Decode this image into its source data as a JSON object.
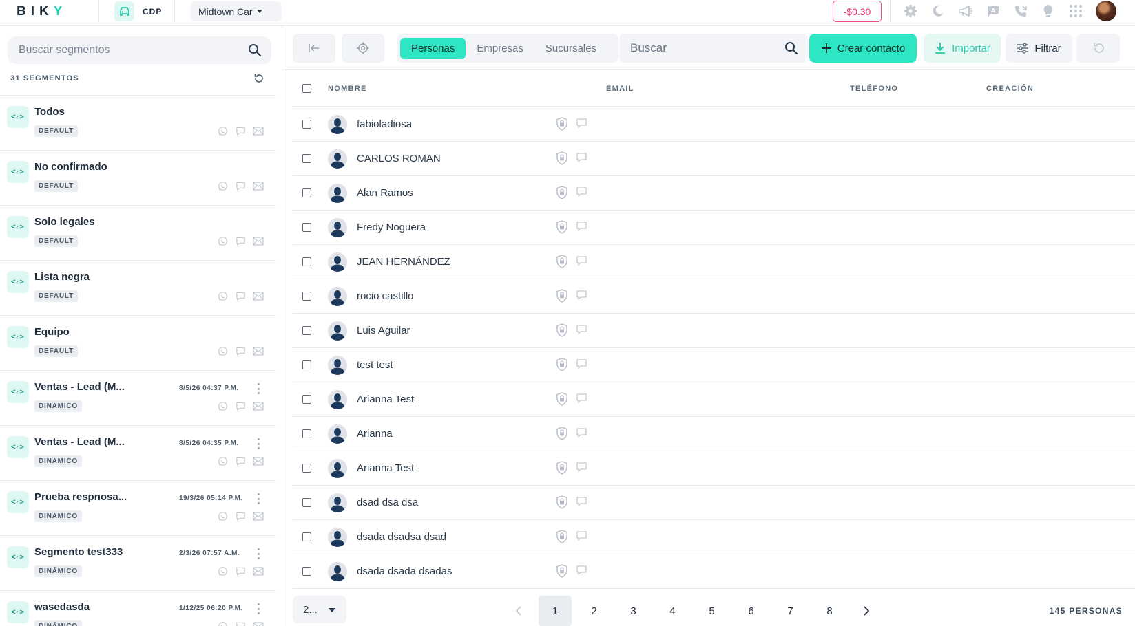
{
  "topbar": {
    "logo": "BIKY",
    "module": "CDP",
    "account": "Midtown Car",
    "balance": "-$0.30",
    "icons": [
      "settings-icon",
      "moon-icon",
      "megaphone-icon",
      "chat-letter-icon",
      "phone-icon",
      "lightbulb-icon",
      "apps-grid-icon",
      "avatar"
    ]
  },
  "sidebar": {
    "search_placeholder": "Buscar segmentos",
    "count_label": "31 SEGMENTOS",
    "segments": [
      {
        "name": "Todos",
        "badge": "DEFAULT",
        "date": ""
      },
      {
        "name": "No confirmado",
        "badge": "DEFAULT",
        "date": ""
      },
      {
        "name": "Solo legales",
        "badge": "DEFAULT",
        "date": ""
      },
      {
        "name": "Lista negra",
        "badge": "DEFAULT",
        "date": ""
      },
      {
        "name": "Equipo",
        "badge": "DEFAULT",
        "date": ""
      },
      {
        "name": "Ventas - Lead (M...",
        "badge": "DINÁMICO",
        "date": "8/5/26 04:37 P.M."
      },
      {
        "name": "Ventas - Lead (M...",
        "badge": "DINÁMICO",
        "date": "8/5/26 04:35 P.M."
      },
      {
        "name": "Prueba respnosa...",
        "badge": "DINÁMICO",
        "date": "19/3/26 05:14 P.M."
      },
      {
        "name": "Segmento test333",
        "badge": "DINÁMICO",
        "date": "2/3/26 07:57 A.M."
      },
      {
        "name": "wasedasda",
        "badge": "DINÁMICO",
        "date": "1/12/25 06:20 P.M."
      }
    ],
    "tile_glyph": "<·>"
  },
  "toolbar": {
    "tabs": [
      "Personas",
      "Empresas",
      "Sucursales"
    ],
    "active_tab": "Personas",
    "search_placeholder": "Buscar",
    "create_label": "Crear contacto",
    "import_label": "Importar",
    "filter_label": "Filtrar"
  },
  "table": {
    "columns": [
      "NOMBRE",
      "EMAIL",
      "TELÉFONO",
      "CREACIÓN"
    ],
    "rows": [
      {
        "name": "fabioladiosa"
      },
      {
        "name": "CARLOS ROMAN"
      },
      {
        "name": "Alan Ramos"
      },
      {
        "name": "Fredy Noguera"
      },
      {
        "name": "JEAN HERNÁNDEZ"
      },
      {
        "name": "rocio castillo"
      },
      {
        "name": "Luis Aguilar"
      },
      {
        "name": "test test"
      },
      {
        "name": "Arianna Test"
      },
      {
        "name": "Arianna"
      },
      {
        "name": "Arianna Test"
      },
      {
        "name": "dsad dsa dsa"
      },
      {
        "name": "dsada dsadsa dsad"
      },
      {
        "name": "dsada dsada dsadas"
      }
    ]
  },
  "pagination": {
    "page_size": "2...",
    "pages": [
      "1",
      "2",
      "3",
      "4",
      "5",
      "6",
      "7",
      "8"
    ],
    "current": "1",
    "total": "145 PERSONAS"
  },
  "colors": {
    "accent": "#2ee6c4",
    "accent_soft": "#dff7f2",
    "danger": "#e8336c"
  }
}
